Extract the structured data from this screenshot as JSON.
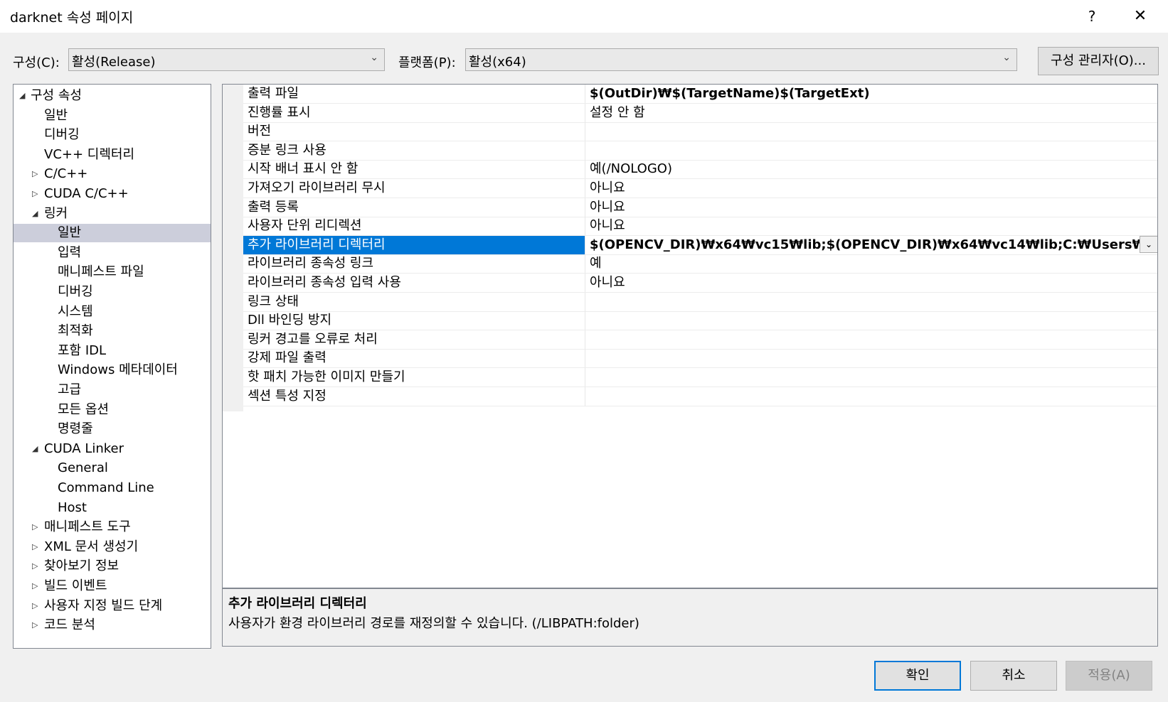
{
  "window": {
    "title": "darknet 속성 페이지",
    "help": "?",
    "close": "✕"
  },
  "toolbar": {
    "config_label": "구성(C):",
    "config_value": "활성(Release)",
    "platform_label": "플랫폼(P):",
    "platform_value": "활성(x64)",
    "config_manager": "구성 관리자(O)..."
  },
  "tree": {
    "items": [
      {
        "label": "구성 속성",
        "twisty": "◢"
      },
      {
        "label": "일반"
      },
      {
        "label": "디버깅"
      },
      {
        "label": "VC++ 디렉터리"
      },
      {
        "label": "C/C++",
        "twisty": "▷"
      },
      {
        "label": "CUDA C/C++",
        "twisty": "▷"
      },
      {
        "label": "링커",
        "twisty": "◢"
      },
      {
        "label": "일반",
        "selected": true
      },
      {
        "label": "입력"
      },
      {
        "label": "매니페스트 파일"
      },
      {
        "label": "디버깅"
      },
      {
        "label": "시스템"
      },
      {
        "label": "최적화"
      },
      {
        "label": "포함 IDL"
      },
      {
        "label": "Windows 메타데이터"
      },
      {
        "label": "고급"
      },
      {
        "label": "모든 옵션"
      },
      {
        "label": "명령줄"
      },
      {
        "label": "CUDA Linker",
        "twisty": "◢"
      },
      {
        "label": "General"
      },
      {
        "label": "Command Line"
      },
      {
        "label": "Host"
      },
      {
        "label": "매니페스트 도구",
        "twisty": "▷"
      },
      {
        "label": "XML 문서 생성기",
        "twisty": "▷"
      },
      {
        "label": "찾아보기 정보",
        "twisty": "▷"
      },
      {
        "label": "빌드 이벤트",
        "twisty": "▷"
      },
      {
        "label": "사용자 지정 빌드 단계",
        "twisty": "▷"
      },
      {
        "label": "코드 분석",
        "twisty": "▷"
      }
    ]
  },
  "grid": {
    "rows": [
      {
        "name": "출력 파일",
        "value": "$(OutDir)₩$(TargetName)$(TargetExt)",
        "bold": true
      },
      {
        "name": "진행률 표시",
        "value": "설정 안 함"
      },
      {
        "name": "버전",
        "value": ""
      },
      {
        "name": "증분 링크 사용",
        "value": ""
      },
      {
        "name": "시작 배너 표시 안 함",
        "value": "예(/NOLOGO)"
      },
      {
        "name": "가져오기 라이브러리 무시",
        "value": "아니요"
      },
      {
        "name": "출력 등록",
        "value": "아니요"
      },
      {
        "name": "사용자 단위 리디렉션",
        "value": "아니요"
      },
      {
        "name": "추가 라이브러리 디렉터리",
        "value": "$(OPENCV_DIR)₩x64₩vc15₩lib;$(OPENCV_DIR)₩x64₩vc14₩lib;C:₩Users₩boss₩Document",
        "bold": true,
        "selected": true
      },
      {
        "name": "라이브러리 종속성 링크",
        "value": "예"
      },
      {
        "name": "라이브러리 종속성 입력 사용",
        "value": "아니요"
      },
      {
        "name": "링크 상태",
        "value": ""
      },
      {
        "name": "Dll 바인딩 방지",
        "value": ""
      },
      {
        "name": "링커 경고를 오류로 처리",
        "value": ""
      },
      {
        "name": "강제 파일 출력",
        "value": ""
      },
      {
        "name": "핫 패치 가능한 이미지 만들기",
        "value": ""
      },
      {
        "name": "섹션 특성 지정",
        "value": ""
      }
    ]
  },
  "description": {
    "title": "추가 라이브러리 디렉터리",
    "text": "사용자가 환경 라이브러리 경로를 재정의할 수 있습니다. (/LIBPATH:folder)"
  },
  "buttons": {
    "ok": "확인",
    "cancel": "취소",
    "apply": "적용(A)"
  },
  "colors": {
    "selection_accent": "#0078d7",
    "tree_selection": "#cccedb"
  }
}
